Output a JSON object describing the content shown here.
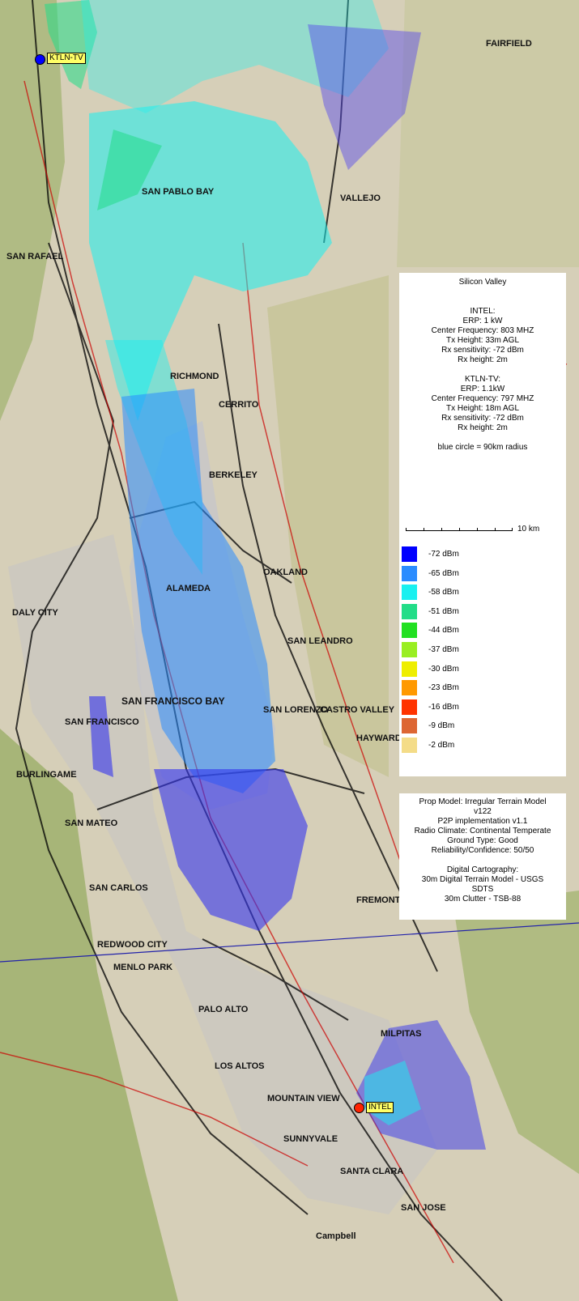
{
  "map": {
    "place_labels": [
      "FAIRFIELD",
      "VALLEJO",
      "SAN PABLO BAY",
      "SAN RAFAEL",
      "RICHMOND",
      "CERRITO",
      "BERKELEY",
      "OAKLAND",
      "ALAMEDA",
      "DALY CITY",
      "SAN FRANCISCO",
      "SAN LEANDRO",
      "SAN LORENZO",
      "CASTRO VALLEY",
      "HAYWARD",
      "SAN FRANCISCO BAY",
      "BURLINGAME",
      "SAN MATEO",
      "SAN CARLOS",
      "REDWOOD CITY",
      "MENLO PARK",
      "PALO ALTO",
      "FREMONT",
      "MILPITAS",
      "LOS ALTOS",
      "MOUNTAIN VIEW",
      "SUNNYVALE",
      "SANTA CLARA",
      "SAN JOSE",
      "Campbell"
    ],
    "sites": [
      {
        "name": "KTLN-TV",
        "dot_color": "#0000ff"
      },
      {
        "name": "INTEL",
        "dot_color": "#ff2200"
      }
    ]
  },
  "legend": {
    "title": "Silicon Valley",
    "intel": {
      "heading": "INTEL:",
      "erp": "ERP: 1 kW",
      "freq": "Center Frequency: 803 MHZ",
      "tx": "Tx Height: 33m AGL",
      "rx_sens": "Rx sensitivity: -72 dBm",
      "rx_h": "Rx height: 2m"
    },
    "ktln": {
      "heading": "KTLN-TV:",
      "erp": "ERP: 1.1kW",
      "freq": "Center Frequency: 797 MHZ",
      "tx": "Tx Height: 18m AGL",
      "rx_sens": "Rx sensitivity: -72 dBm",
      "rx_h": "Rx height: 2m"
    },
    "circle_note": "blue circle = 90km radius",
    "scale_label": "10 km",
    "levels": [
      {
        "label": "-72 dBm",
        "color": "#0000ff"
      },
      {
        "label": "-65 dBm",
        "color": "#2a8cff"
      },
      {
        "label": "-58 dBm",
        "color": "#19f0f0"
      },
      {
        "label": "-51 dBm",
        "color": "#22dd88"
      },
      {
        "label": "-44 dBm",
        "color": "#22e022"
      },
      {
        "label": "-37 dBm",
        "color": "#99ee22"
      },
      {
        "label": "-30 dBm",
        "color": "#eeee00"
      },
      {
        "label": "-23 dBm",
        "color": "#ff9900"
      },
      {
        "label": "-16 dBm",
        "color": "#ff3300"
      },
      {
        "label": "-9 dBm",
        "color": "#dd6633"
      },
      {
        "label": "-2 dBm",
        "color": "#f4dc88"
      }
    ]
  },
  "model": {
    "line1": "Prop Model: Irregular Terrain Model",
    "line2": "v122",
    "line3": "P2P implementation v1.1",
    "line4": "Radio Climate: Continental Temperate",
    "line5": "Ground Type: Good",
    "line6": "Reliability/Confidence: 50/50",
    "line7": "Digital Cartography:",
    "line8": "30m Digital Terrain Model - USGS",
    "line9": "SDTS",
    "line10": "30m Clutter - TSB-88"
  }
}
